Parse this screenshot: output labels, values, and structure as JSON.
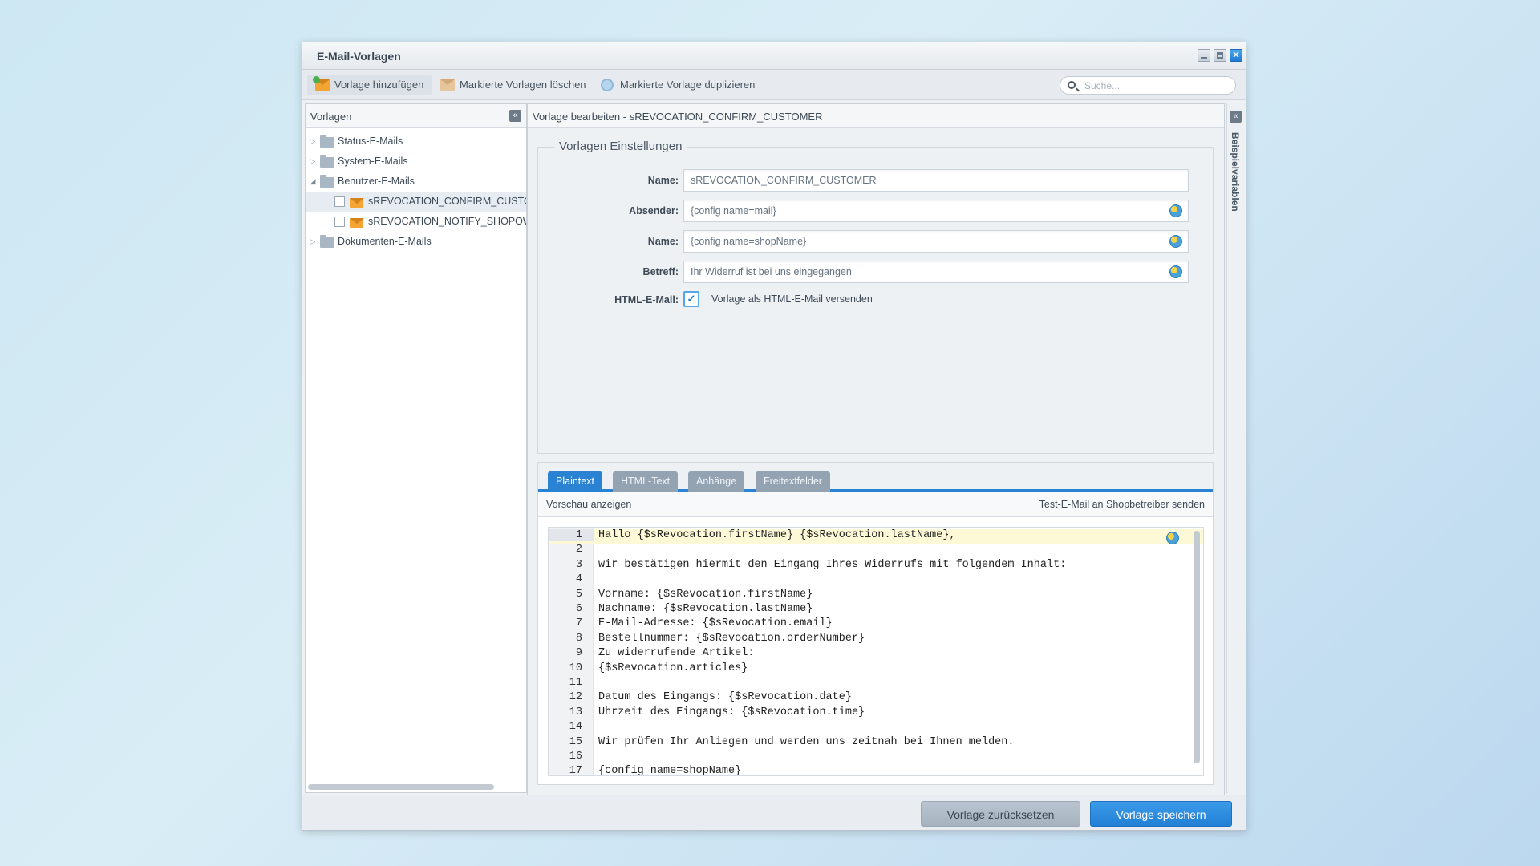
{
  "window": {
    "title": "E-Mail-Vorlagen"
  },
  "toolbar": {
    "add_label": "Vorlage hinzufügen",
    "delete_label": "Markierte Vorlagen löschen",
    "duplicate_label": "Markierte Vorlage duplizieren",
    "search_placeholder": "Suche..."
  },
  "tree": {
    "header": "Vorlagen",
    "collapse_glyph": "«",
    "nodes": [
      {
        "label": "Status-E-Mails",
        "arrow": "▷"
      },
      {
        "label": "System-E-Mails",
        "arrow": "▷"
      },
      {
        "label": "Benutzer-E-Mails",
        "arrow": "◢"
      },
      {
        "label": "sREVOCATION_CONFIRM_CUSTOMER"
      },
      {
        "label": "sREVOCATION_NOTIFY_SHOPOWNER"
      },
      {
        "label": "Dokumenten-E-Mails",
        "arrow": "▷"
      }
    ]
  },
  "editor": {
    "header": "Vorlage bearbeiten - sREVOCATION_CONFIRM_CUSTOMER",
    "settings_title": "Vorlagen Einstellungen",
    "fields": {
      "name_label": "Name:",
      "name_value": "sREVOCATION_CONFIRM_CUSTOMER",
      "sender_label": "Absender:",
      "sender_value": "{config name=mail}",
      "sender_name_label": "Name:",
      "sender_name_value": "{config name=shopName}",
      "subject_label": "Betreff:",
      "subject_value": "Ihr Widerruf ist bei uns eingegangen",
      "html_label": "HTML-E-Mail:",
      "html_checked": "✓",
      "html_checkbox_label": "Vorlage als HTML-E-Mail versenden"
    },
    "tabs": [
      "Plaintext",
      "HTML-Text",
      "Anhänge",
      "Freitextfelder"
    ],
    "preview_label": "Vorschau anzeigen",
    "test_mail_label": "Test-E-Mail an Shopbetreiber senden",
    "code_lines": [
      "Hallo {$sRevocation.firstName} {$sRevocation.lastName},",
      "",
      "wir bestätigen hiermit den Eingang Ihres Widerrufs mit folgendem Inhalt:",
      "",
      "Vorname: {$sRevocation.firstName}",
      "Nachname: {$sRevocation.lastName}",
      "E-Mail-Adresse: {$sRevocation.email}",
      "Bestellnummer: {$sRevocation.orderNumber}",
      "Zu widerrufende Artikel:",
      "{$sRevocation.articles}",
      "",
      "Datum des Eingangs: {$sRevocation.date}",
      "Uhrzeit des Eingangs: {$sRevocation.time}",
      "",
      "Wir prüfen Ihr Anliegen und werden uns zeitnah bei Ihnen melden.",
      "",
      "{config name=shopName}"
    ]
  },
  "sidebar": {
    "title": "Beispielvariablen",
    "collapse_glyph": "«"
  },
  "footer": {
    "reset_label": "Vorlage zurücksetzen",
    "save_label": "Vorlage speichern"
  },
  "colors": {
    "accent": "#2a82d3",
    "envelope": "#f3a432"
  }
}
